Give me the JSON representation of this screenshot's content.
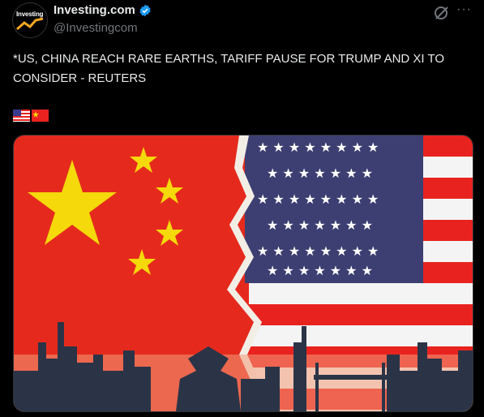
{
  "author": {
    "display_name": "Investing.com",
    "handle": "@Investingcom",
    "avatar_text": "Investing"
  },
  "tweet": {
    "text": "*US, CHINA REACH RARE EARTHS, TARIFF PAUSE FOR TRUMP AND XI TO CONSIDER - REUTERS"
  },
  "flags": [
    "us-flag-emoji",
    "china-flag-emoji"
  ],
  "icons": {
    "verified": "verified-badge-icon",
    "grok": "grok-icon",
    "more": "more-icon"
  },
  "colors": {
    "background": "#000000",
    "text": "#e7e9ea",
    "secondary_text": "#71767b",
    "verified_blue": "#1d9bf0",
    "china_red": "#e8231f",
    "china_star": "#f5d90a",
    "us_blue": "#3b3b6e",
    "us_red": "#e8231f"
  },
  "media": {
    "description_icon": "us-china-flags-image"
  }
}
